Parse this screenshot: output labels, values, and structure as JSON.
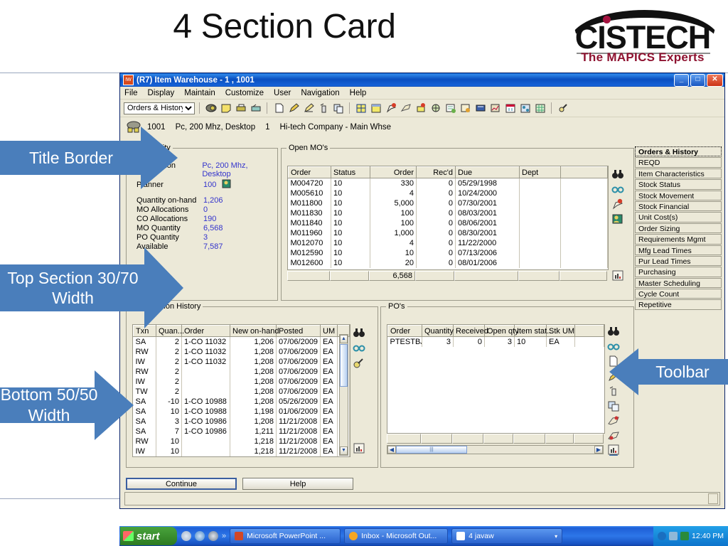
{
  "slide": {
    "title": "4 Section Card",
    "logo": {
      "name": "CISTECH",
      "tagline": "The MAPICS Experts"
    }
  },
  "callouts": [
    {
      "id": "title-border",
      "label": "Title Border"
    },
    {
      "id": "top-section",
      "label": "Top Section 30/70 Width"
    },
    {
      "id": "bottom-section",
      "label": "Bottom 50/50 Width"
    },
    {
      "id": "toolbar",
      "label": "Toolbar"
    }
  ],
  "window": {
    "title": "(R7) Item Warehouse - 1 , 1001",
    "titlebar_icon": "app-icon",
    "buttons": {
      "minimize": "_",
      "maximize": "□",
      "close": "✕"
    },
    "menus": [
      "File",
      "Display",
      "Maintain",
      "Customize",
      "User",
      "Navigation",
      "Help"
    ],
    "toolbar": {
      "dropdown_value": "Orders & History",
      "icons": [
        "view-icon",
        "note-icon",
        "print-icon",
        "fax-icon",
        "new-icon",
        "edit-icon",
        "edit-list-icon",
        "delete-icon",
        "copy-icon",
        "grid-icon",
        "window-icon",
        "mo-icon",
        "co-icon",
        "po-icon",
        "globe-icon",
        "report-icon",
        "document-icon",
        "label-icon",
        "forecast-icon",
        "calendar-icon",
        "network-icon",
        "matrix-icon",
        "attach-icon"
      ]
    },
    "identity": {
      "icon": "warehouse-icon",
      "item": "1001",
      "description": "Pc, 200 Mhz, Desktop",
      "warehouse": "1",
      "company": "Hi-tech Company - Main Whse"
    },
    "footer_buttons": {
      "continue": "Continue",
      "help": "Help"
    }
  },
  "availability": {
    "legend": "Availability",
    "rows": [
      {
        "label": "Description",
        "value": "Pc, 200 Mhz, Desktop"
      },
      {
        "label": "Planner",
        "value": "100",
        "icon": "planner-icon"
      },
      {
        "label": "Quantity on-hand",
        "value": "1,206"
      },
      {
        "label": "MO Allocations",
        "value": "0"
      },
      {
        "label": "CO Allocations",
        "value": "190"
      },
      {
        "label": "MO Quantity",
        "value": "6,568"
      },
      {
        "label": "PO Quantity",
        "value": "3"
      },
      {
        "label": "Available",
        "value": "7,587"
      }
    ],
    "value_color": "#3333cc"
  },
  "open_mos": {
    "legend": "Open MO's",
    "columns": [
      "Order",
      "Status",
      "Order",
      "Rec'd",
      "Due",
      "Dept",
      ""
    ],
    "rows": [
      [
        "M004720",
        "10",
        "330",
        "0",
        "05/29/1998",
        "",
        ""
      ],
      [
        "M005610",
        "10",
        "4",
        "0",
        "10/24/2000",
        "",
        ""
      ],
      [
        "M011800",
        "10",
        "5,000",
        "0",
        "07/30/2001",
        "",
        ""
      ],
      [
        "M011830",
        "10",
        "100",
        "0",
        "08/03/2001",
        "",
        ""
      ],
      [
        "M011840",
        "10",
        "100",
        "0",
        "08/06/2001",
        "",
        ""
      ],
      [
        "M011960",
        "10",
        "1,000",
        "0",
        "08/30/2001",
        "",
        ""
      ],
      [
        "M012070",
        "10",
        "4",
        "0",
        "11/22/2000",
        "",
        ""
      ],
      [
        "M012590",
        "10",
        "10",
        "0",
        "07/13/2006",
        "",
        ""
      ],
      [
        "M012600",
        "10",
        "20",
        "0",
        "08/01/2006",
        "",
        ""
      ]
    ],
    "totals": [
      "",
      "",
      "6,568",
      "",
      "",
      "",
      ""
    ],
    "rail_icons": [
      "binoculars-icon",
      "glasses-icon",
      "flag-icon",
      "person-icon"
    ],
    "chart_icon": "chart-icon"
  },
  "transaction_history": {
    "legend": "Transaction History",
    "columns": [
      "Txn",
      "Quan...",
      "Order",
      "New on-hand",
      "Posted",
      "UM",
      ""
    ],
    "rows": [
      [
        "SA",
        "2",
        "1-CO  11032",
        "1,206",
        "07/06/2009",
        "EA",
        ""
      ],
      [
        "RW",
        "2",
        "1-CO  11032",
        "1,208",
        "07/06/2009",
        "EA",
        ""
      ],
      [
        "IW",
        "2",
        "1-CO  11032",
        "1,208",
        "07/06/2009",
        "EA",
        ""
      ],
      [
        "RW",
        "2",
        "",
        "1,208",
        "07/06/2009",
        "EA",
        ""
      ],
      [
        "IW",
        "2",
        "",
        "1,208",
        "07/06/2009",
        "EA",
        ""
      ],
      [
        "TW",
        "2",
        "",
        "1,208",
        "07/06/2009",
        "EA",
        ""
      ],
      [
        "SA",
        "-10",
        "1-CO  10988",
        "1,208",
        "05/26/2009",
        "EA",
        ""
      ],
      [
        "SA",
        "10",
        "1-CO  10988",
        "1,198",
        "01/06/2009",
        "EA",
        ""
      ],
      [
        "SA",
        "3",
        "1-CO  10986",
        "1,208",
        "11/21/2008",
        "EA",
        ""
      ],
      [
        "SA",
        "7",
        "1-CO  10986",
        "1,211",
        "11/21/2008",
        "EA",
        ""
      ],
      [
        "RW",
        "10",
        "",
        "1,218",
        "11/21/2008",
        "EA",
        ""
      ],
      [
        "IW",
        "10",
        "",
        "1,218",
        "11/21/2008",
        "EA",
        ""
      ]
    ],
    "rail_icons": [
      "binoculars-icon",
      "glasses-icon",
      "attach-icon"
    ],
    "chart_icon": "chart-icon"
  },
  "pos": {
    "legend": "PO's",
    "columns": [
      "Order",
      "Quantity",
      "Received",
      "Open qty",
      "Item stat...",
      "Stk UM",
      ""
    ],
    "rows": [
      [
        "PTESTBJ",
        "3",
        "0",
        "3",
        "10",
        "EA",
        ""
      ]
    ],
    "rail_icons": [
      "binoculars-icon",
      "glasses-icon",
      "new-icon",
      "edit-icon",
      "delete-icon",
      "copy-icon",
      "receipt-icon",
      "return-icon",
      "vendor-icon"
    ],
    "chart_icon": "chart-icon"
  },
  "nav": {
    "selected": "Orders & History",
    "items": [
      "Orders & History",
      "REQD",
      "Item Characteristics",
      "Stock Status",
      "Stock Movement",
      "Stock Financial",
      "Unit Cost(s)",
      "Order Sizing",
      "Requirements Mgmt",
      "Mfg Lead Times",
      "Pur Lead Times",
      "Purchasing",
      "Master Scheduling",
      "Cycle Count",
      "Repetitive"
    ]
  },
  "taskbar": {
    "start": "start",
    "quick_launch": [
      "media-icon",
      "browser-icon",
      "explorer-icon",
      "chevron-more-icon"
    ],
    "tasks": [
      {
        "label": "Microsoft PowerPoint ...",
        "icon": "powerpoint-icon",
        "color": "#d24726"
      },
      {
        "label": "Inbox - Microsoft Out...",
        "icon": "outlook-icon",
        "color": "#f5a623"
      },
      {
        "label": "4 javaw",
        "icon": "java-icon",
        "color": "#ffffff"
      }
    ],
    "tray": {
      "icons": [
        "volume-icon",
        "network-icon",
        "shield-icon"
      ],
      "clock": "12:40 PM"
    }
  }
}
